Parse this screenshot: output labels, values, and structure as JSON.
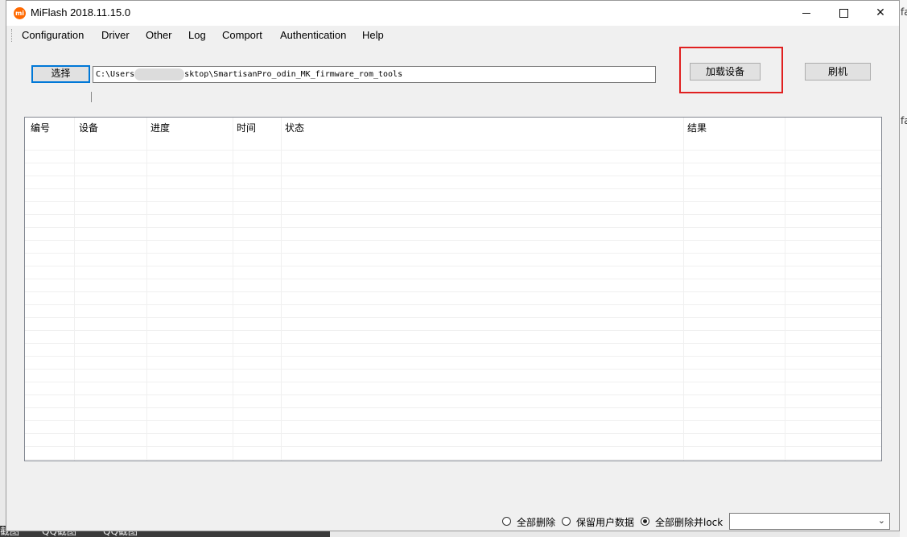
{
  "window": {
    "title": "MiFlash 2018.11.15.0",
    "app_icon_text": "mi",
    "controls": {
      "minimize": "—",
      "maximize": "☐",
      "close": "✕"
    }
  },
  "menu": {
    "items": [
      "Configuration",
      "Driver",
      "Other",
      "Log",
      "Comport",
      "Authentication",
      "Help"
    ]
  },
  "toolbar": {
    "select_label": "选择",
    "path_prefix": "C:\\Users",
    "path_suffix": "sktop\\SmartisanPro_odin_MK_firmware_rom_tools",
    "load_device_label": "加载设备",
    "flash_label": "刷机"
  },
  "table": {
    "headers": [
      "编号",
      "设备",
      "进度",
      "时间",
      "状态",
      "结果"
    ],
    "rows": []
  },
  "options": {
    "radio": [
      {
        "label": "全部删除",
        "checked": false
      },
      {
        "label": "保留用户数据",
        "checked": false
      },
      {
        "label": "全部删除并lock",
        "checked": true
      }
    ],
    "dropdown_value": ""
  },
  "background": {
    "right_edge_text_1": "fa",
    "right_edge_text_2": "fa",
    "taskbar_items": [
      "截图",
      "QQ截图",
      "QQ截图"
    ]
  },
  "colors": {
    "highlight": "#e02020",
    "focus_border": "#0078d7",
    "app_icon": "#ff6900"
  }
}
